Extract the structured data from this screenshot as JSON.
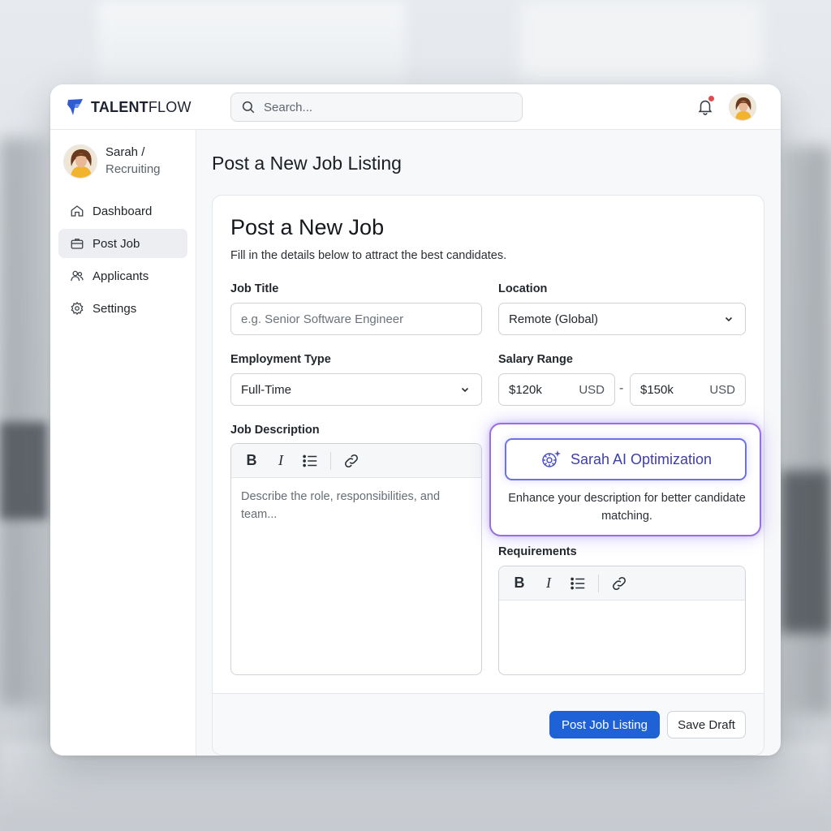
{
  "brand": {
    "name_bold": "TALENT",
    "name_rest": "FLOW",
    "accent": "#2f5bd3"
  },
  "search": {
    "placeholder": "Search..."
  },
  "header": {
    "bell_icon": "bell-icon",
    "notification_dot_color": "#e5484d"
  },
  "profile": {
    "name": "Sarah /",
    "role": "Recruiting"
  },
  "sidebar": {
    "items": [
      {
        "label": "Dashboard",
        "icon": "home-icon",
        "active": false
      },
      {
        "label": "Post Job",
        "icon": "briefcase-icon",
        "active": true
      },
      {
        "label": "Applicants",
        "icon": "users-icon",
        "active": false
      },
      {
        "label": "Settings",
        "icon": "gear-icon",
        "active": false
      }
    ]
  },
  "main": {
    "page_title": "Post a New Job Listing"
  },
  "form": {
    "title": "Post a New Job",
    "subtitle": "Fill in the details below to attract the best candidates.",
    "job_title": {
      "label": "Job Title",
      "placeholder": "e.g. Senior Software Engineer"
    },
    "location": {
      "label": "Location",
      "value": "Remote (Global)"
    },
    "employment_type": {
      "label": "Employment Type",
      "value": "Full-Time"
    },
    "salary": {
      "label": "Salary Range",
      "min": "$120k",
      "min_currency": "USD",
      "separator": "-",
      "max": "$150k",
      "max_currency": "USD"
    },
    "description": {
      "label": "Job Description",
      "placeholder": "Describe the role, responsibilities, and team..."
    },
    "requirements": {
      "label": "Requirements",
      "placeholder": ""
    },
    "toolbar": {
      "bold": "B",
      "italic": "I"
    }
  },
  "ai": {
    "button_label": "Sarah AI Optimization",
    "description": "Enhance your description for better candidate matching.",
    "accent": "#6d72e8",
    "glow": "#9b6ce3"
  },
  "actions": {
    "primary": "Post Job Listing",
    "secondary": "Save Draft",
    "primary_color": "#1f62d8"
  }
}
